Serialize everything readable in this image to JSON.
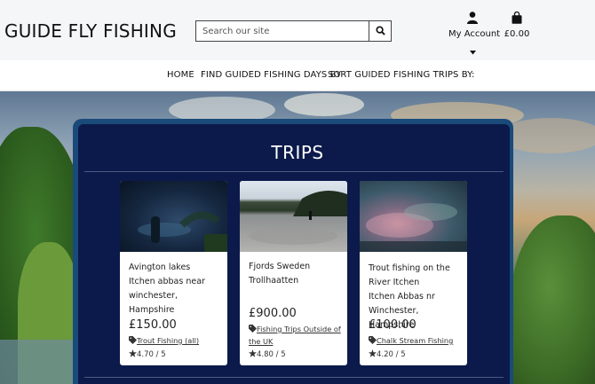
{
  "header": {
    "brand": "GUIDE FLY FISHING",
    "search_placeholder": "Search our site",
    "account_label": "My Account",
    "bag_total": "£0.00"
  },
  "nav": {
    "items": [
      "HOME",
      "FIND GUIDED FISHING DAYS BY",
      "SORT GUIDED FISHING TRIPS BY:"
    ]
  },
  "section": {
    "title": "TRIPS"
  },
  "trips": [
    {
      "name": "Avington lakes",
      "location": "Itchen abbas near winchester, Hampshire",
      "price": "£150.00",
      "category": "Trout Fishing (all)",
      "rating": "4.70 / 5"
    },
    {
      "name": "Fjords Sweden",
      "location": "Trollhaatten",
      "price": "£900.00",
      "category": "Fishing Trips Outside of the UK",
      "rating": "4.80 / 5"
    },
    {
      "name": "Trout fishing on the River Itchen",
      "location": "Itchen Abbas nr Winchester, Hampshire",
      "price": "£100.00",
      "category": "Chalk Stream Fishing",
      "rating": "4.20 / 5"
    }
  ],
  "icons": {
    "search": "search-icon",
    "account": "user-icon",
    "bag": "shopping-bag-icon",
    "tag": "tag-icon",
    "star": "star-icon",
    "caret": "caret-down-icon"
  },
  "colors": {
    "panel": "#0b1a4a",
    "panel_border": "#1a4a7a",
    "header_bg": "#f5f6f8"
  }
}
